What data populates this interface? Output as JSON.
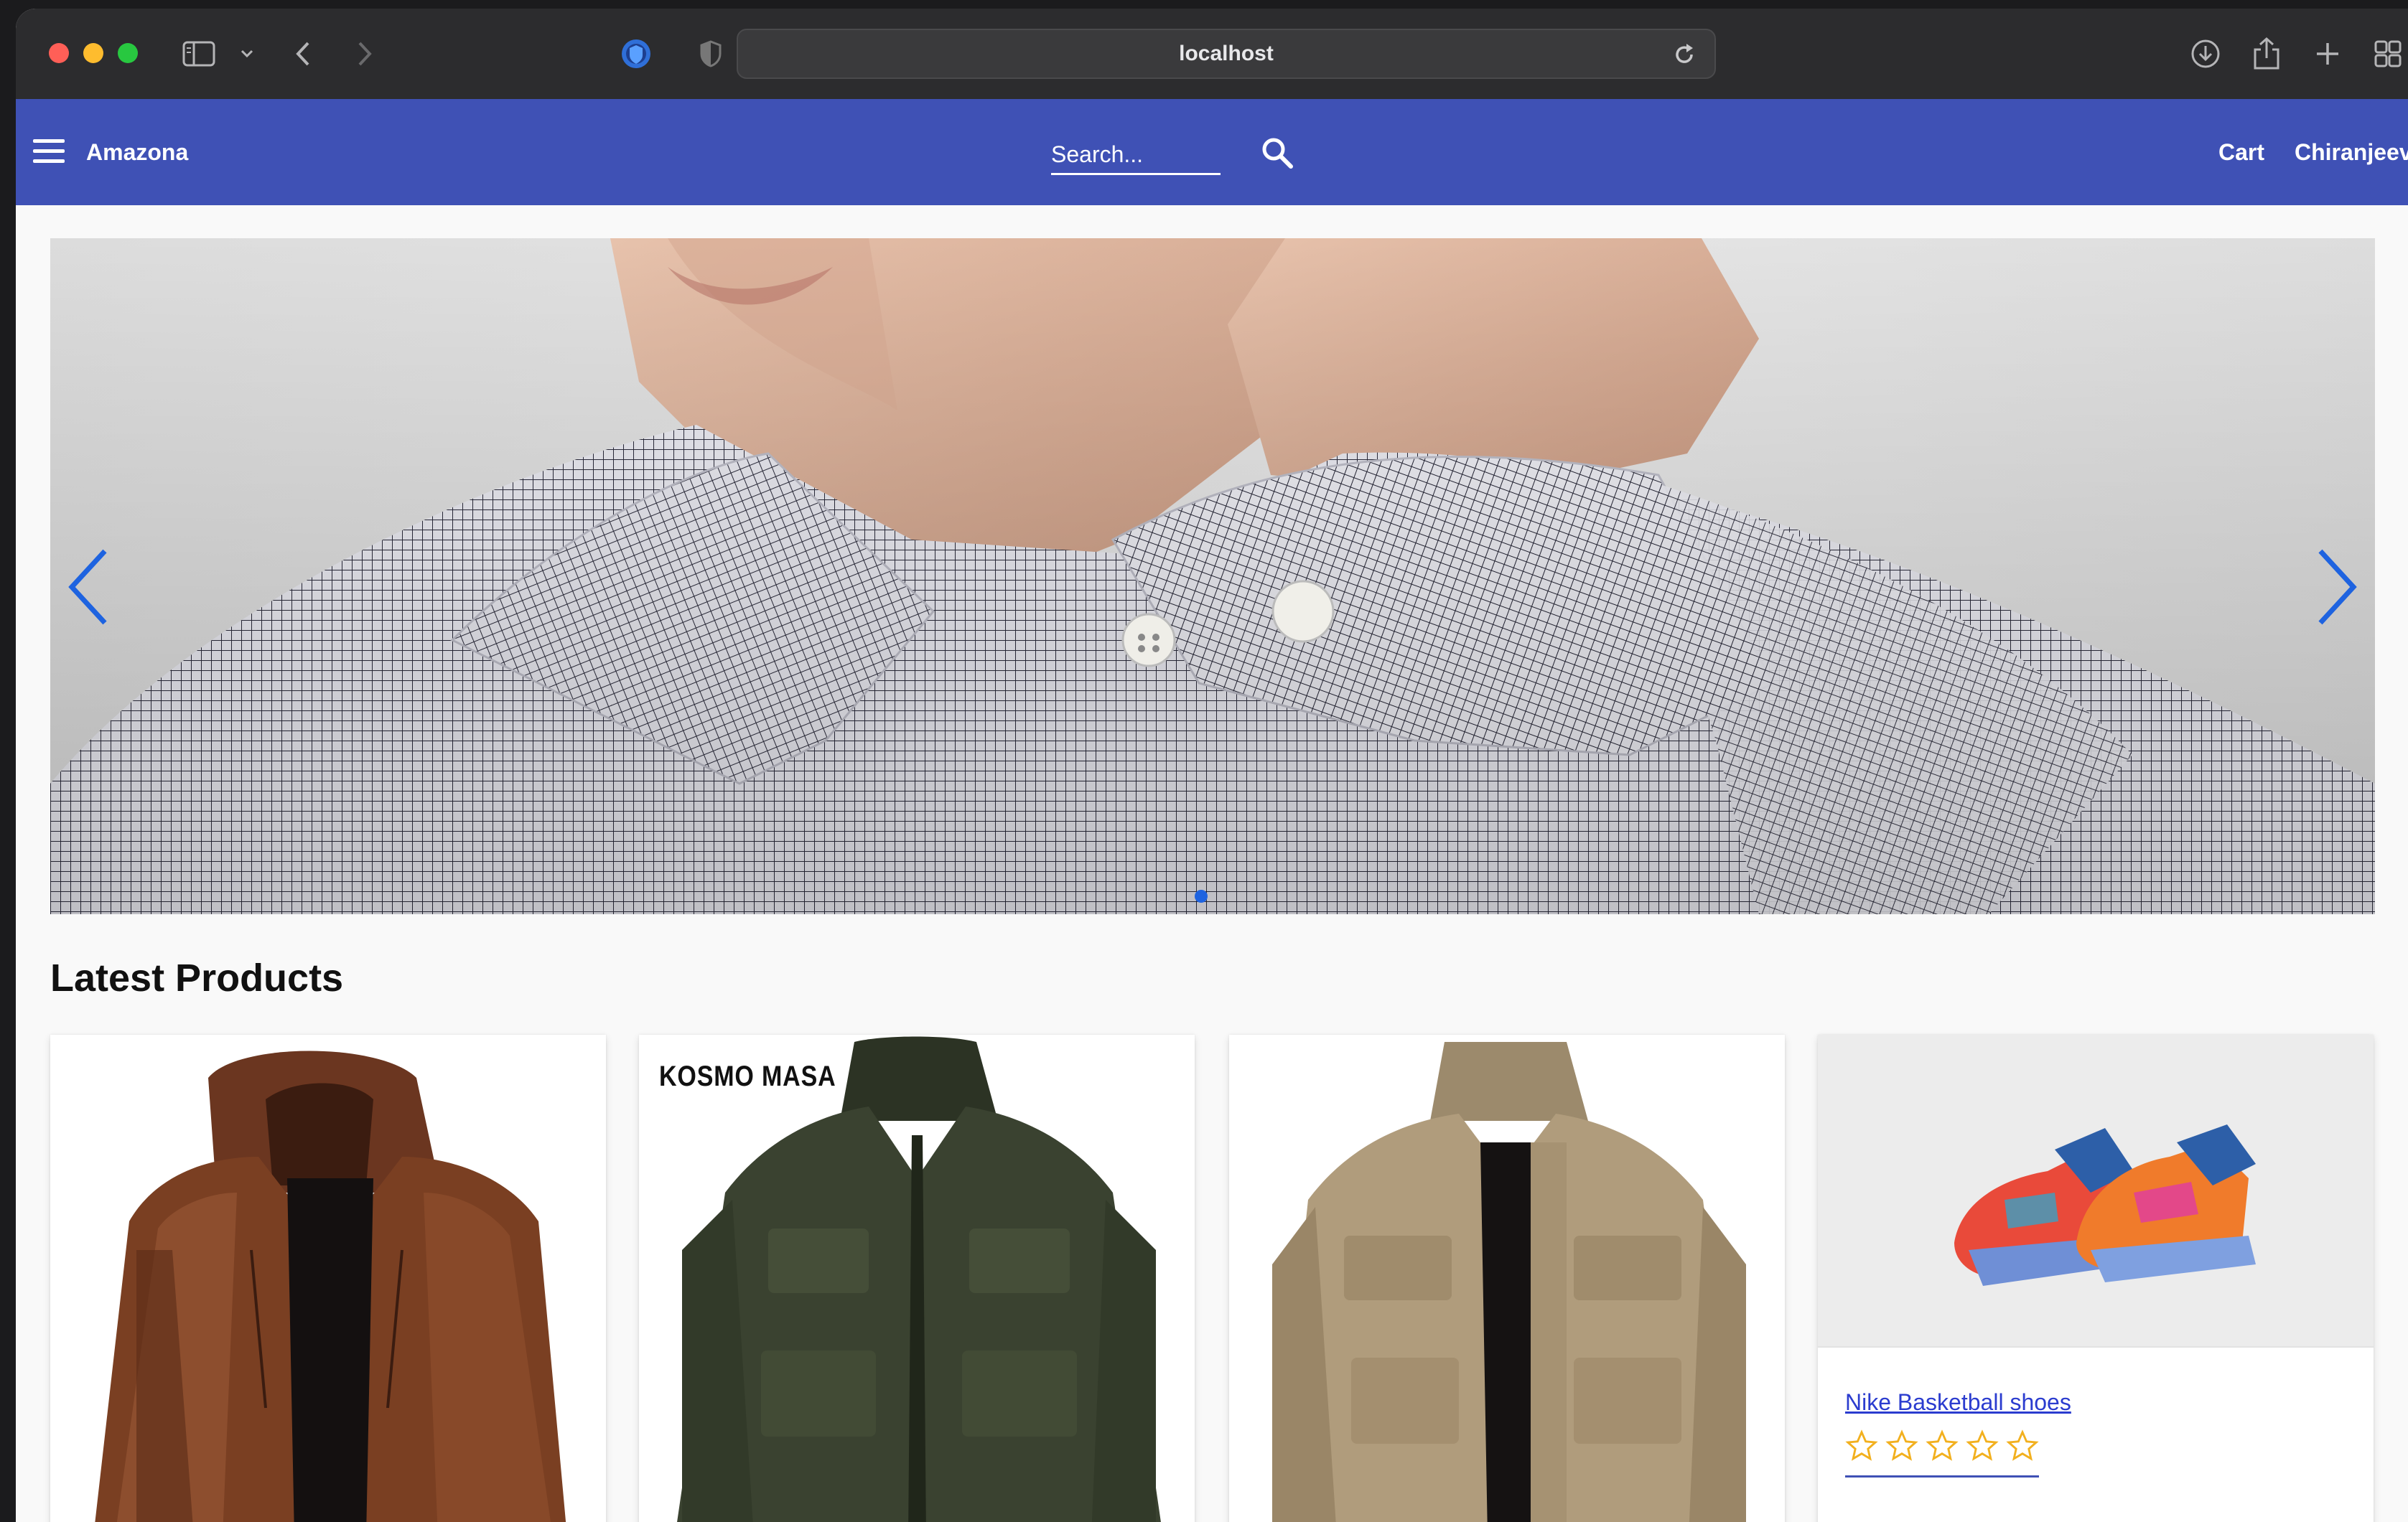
{
  "browser": {
    "url": "localhost"
  },
  "header": {
    "brand": "Amazona",
    "search_placeholder": "Search...",
    "cart_label": "Cart",
    "user_label": "Chiranjeev"
  },
  "carousel": {
    "image_subject": "man in checkered shirt",
    "active_slide": 1
  },
  "products_section": {
    "title": "Latest Products",
    "products": [
      {
        "name": "",
        "image_subject": "brown leather hooded jacket"
      },
      {
        "name": "",
        "brand_text": "KOSMO MASA",
        "image_subject": "olive green field jacket"
      },
      {
        "name": "",
        "image_subject": "khaki military jacket"
      },
      {
        "name": "Nike Basketball shoes",
        "image_subject": "multicolor basketball shoes",
        "rating": 0,
        "rating_max": 5
      }
    ]
  },
  "colors": {
    "header_bg": "#3f51b5",
    "accent": "#1e63e0",
    "star": "#f2b01e"
  },
  "icons": [
    "sidebar-icon",
    "chevron-down-icon",
    "back-icon",
    "forward-icon",
    "privacy-shield-icon",
    "shield-half-icon",
    "reload-icon",
    "download-icon",
    "share-icon",
    "new-tab-icon",
    "tab-overview-icon",
    "hamburger-icon",
    "search-icon",
    "chevron-left-icon",
    "chevron-right-icon",
    "star-icon"
  ]
}
